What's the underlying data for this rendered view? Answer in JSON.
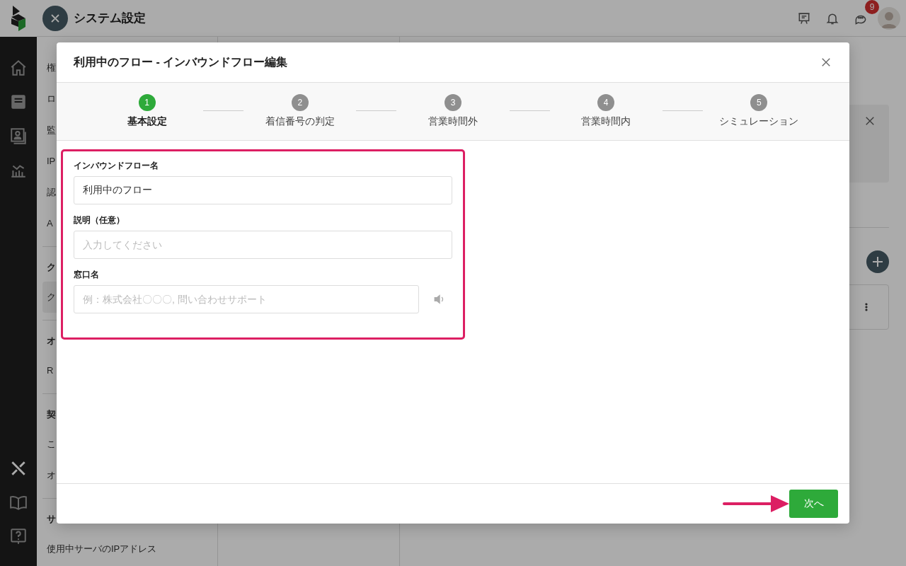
{
  "app_header": {
    "title": "システム設定",
    "notification_badge": "9"
  },
  "rail": {
    "top": [
      {
        "selected": false
      },
      {
        "selected": false
      },
      {
        "selected": false
      },
      {
        "selected": false
      }
    ],
    "bottom": [
      {
        "selected": true
      },
      {
        "selected": false
      },
      {
        "selected": false
      }
    ]
  },
  "settings_menu": [
    {
      "kind": "item",
      "label": "権",
      "selected": false
    },
    {
      "kind": "item",
      "label": "ロ",
      "selected": false
    },
    {
      "kind": "item",
      "label": "監",
      "selected": false
    },
    {
      "kind": "item",
      "label": "IP",
      "selected": false
    },
    {
      "kind": "item",
      "label": "認",
      "selected": false
    },
    {
      "kind": "item",
      "label": "A",
      "selected": false
    },
    {
      "kind": "heading",
      "label": "ク"
    },
    {
      "kind": "item",
      "label": "ク",
      "selected": true
    },
    {
      "kind": "heading",
      "label": "オ"
    },
    {
      "kind": "item",
      "label": "R",
      "selected": false
    },
    {
      "kind": "heading",
      "label": "契"
    },
    {
      "kind": "item",
      "label": "こ",
      "selected": false
    },
    {
      "kind": "item",
      "label": "オ",
      "selected": false
    },
    {
      "kind": "heading",
      "label": "サ"
    },
    {
      "kind": "item",
      "label": "使用中サーバのIPアドレス",
      "selected": false
    }
  ],
  "modal": {
    "title": "利用中のフロー - インバウンドフロー編集",
    "steps": [
      {
        "number": "1",
        "label": "基本設定",
        "selected": true
      },
      {
        "number": "2",
        "label": "着信番号の判定",
        "selected": false
      },
      {
        "number": "3",
        "label": "営業時間外",
        "selected": false
      },
      {
        "number": "4",
        "label": "営業時間内",
        "selected": false
      },
      {
        "number": "5",
        "label": "シミュレーション",
        "selected": false
      }
    ],
    "form": {
      "highlighted": true,
      "fields": [
        {
          "kind": "text",
          "label": "インバウンドフロー名",
          "value": "利用中のフロー"
        },
        {
          "kind": "text",
          "label": "説明（任意）",
          "placeholder": "入力してください"
        },
        {
          "kind": "text_with_audio",
          "label": "窓口名",
          "placeholder": "例：株式会社〇〇〇, 問い合わせサポート"
        }
      ]
    },
    "next_button": "次へ",
    "pointer_arrow": true
  }
}
